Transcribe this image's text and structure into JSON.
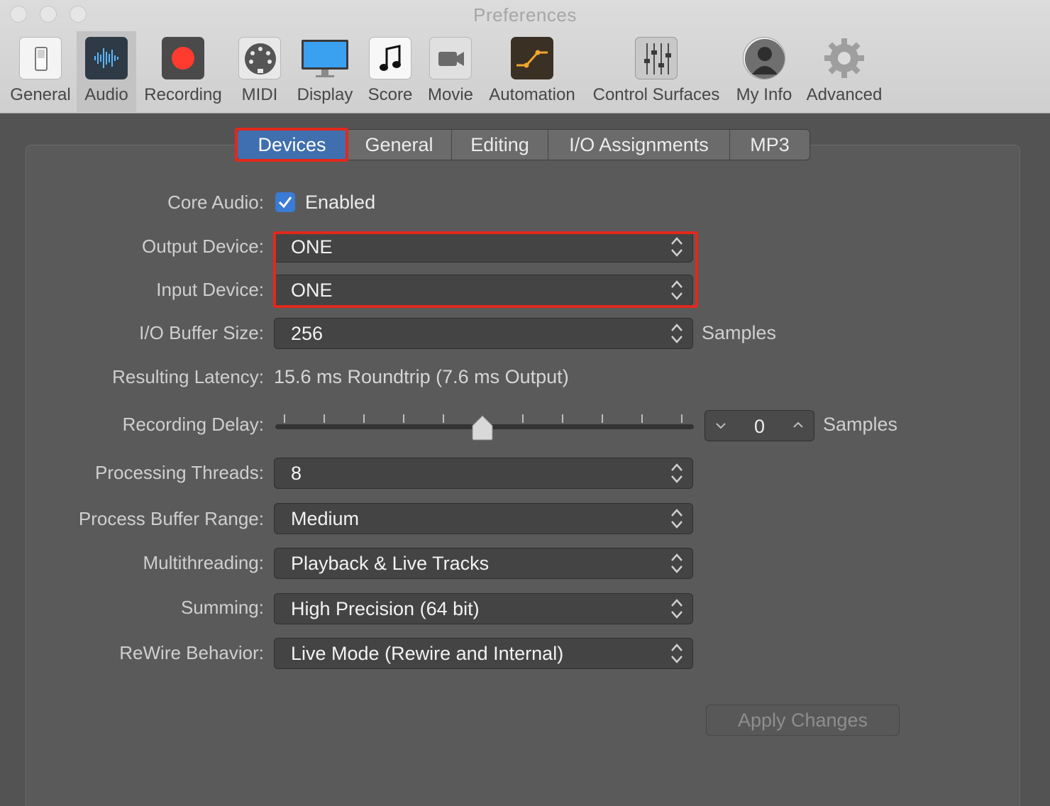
{
  "window": {
    "title": "Preferences"
  },
  "toolbar": {
    "items": [
      {
        "label": "General",
        "icon": "general-switch-icon"
      },
      {
        "label": "Audio",
        "icon": "audio-waveform-icon"
      },
      {
        "label": "Recording",
        "icon": "record-icon"
      },
      {
        "label": "MIDI",
        "icon": "midi-port-icon"
      },
      {
        "label": "Display",
        "icon": "display-monitor-icon"
      },
      {
        "label": "Score",
        "icon": "music-note-icon"
      },
      {
        "label": "Movie",
        "icon": "movie-camera-icon"
      },
      {
        "label": "Automation",
        "icon": "automation-curve-icon"
      },
      {
        "label": "Control Surfaces",
        "icon": "mixer-faders-icon"
      },
      {
        "label": "My Info",
        "icon": "user-silhouette-icon"
      },
      {
        "label": "Advanced",
        "icon": "gear-icon"
      }
    ],
    "active_item": "Audio"
  },
  "tabs": {
    "items": [
      "Devices",
      "General",
      "Editing",
      "I/O Assignments",
      "MP3"
    ],
    "selected": "Devices"
  },
  "form": {
    "core_audio": {
      "label": "Core Audio:",
      "checkbox_label": "Enabled",
      "checked": true
    },
    "output_device": {
      "label": "Output Device:",
      "value": "ONE"
    },
    "input_device": {
      "label": "Input Device:",
      "value": "ONE"
    },
    "io_buffer_size": {
      "label": "I/O Buffer Size:",
      "value": "256",
      "unit": "Samples"
    },
    "resulting_latency": {
      "label": "Resulting Latency:",
      "value": "15.6 ms Roundtrip (7.6 ms Output)"
    },
    "recording_delay": {
      "label": "Recording Delay:",
      "value": "0",
      "unit": "Samples",
      "slider_position": 0.5
    },
    "processing_threads": {
      "label": "Processing Threads:",
      "value": "8"
    },
    "process_buffer_range": {
      "label": "Process Buffer Range:",
      "value": "Medium"
    },
    "multithreading": {
      "label": "Multithreading:",
      "value": "Playback & Live Tracks"
    },
    "summing": {
      "label": "Summing:",
      "value": "High Precision (64 bit)"
    },
    "rewire_behavior": {
      "label": "ReWire Behavior:",
      "value": "Live Mode (Rewire and Internal)"
    }
  },
  "apply_button": {
    "label": "Apply Changes",
    "enabled": false
  },
  "colors": {
    "highlight_box": "#e0291c",
    "selected_tab": "#3f6fae",
    "checkbox": "#3a7bd5",
    "panel": "#5a5a5a"
  }
}
